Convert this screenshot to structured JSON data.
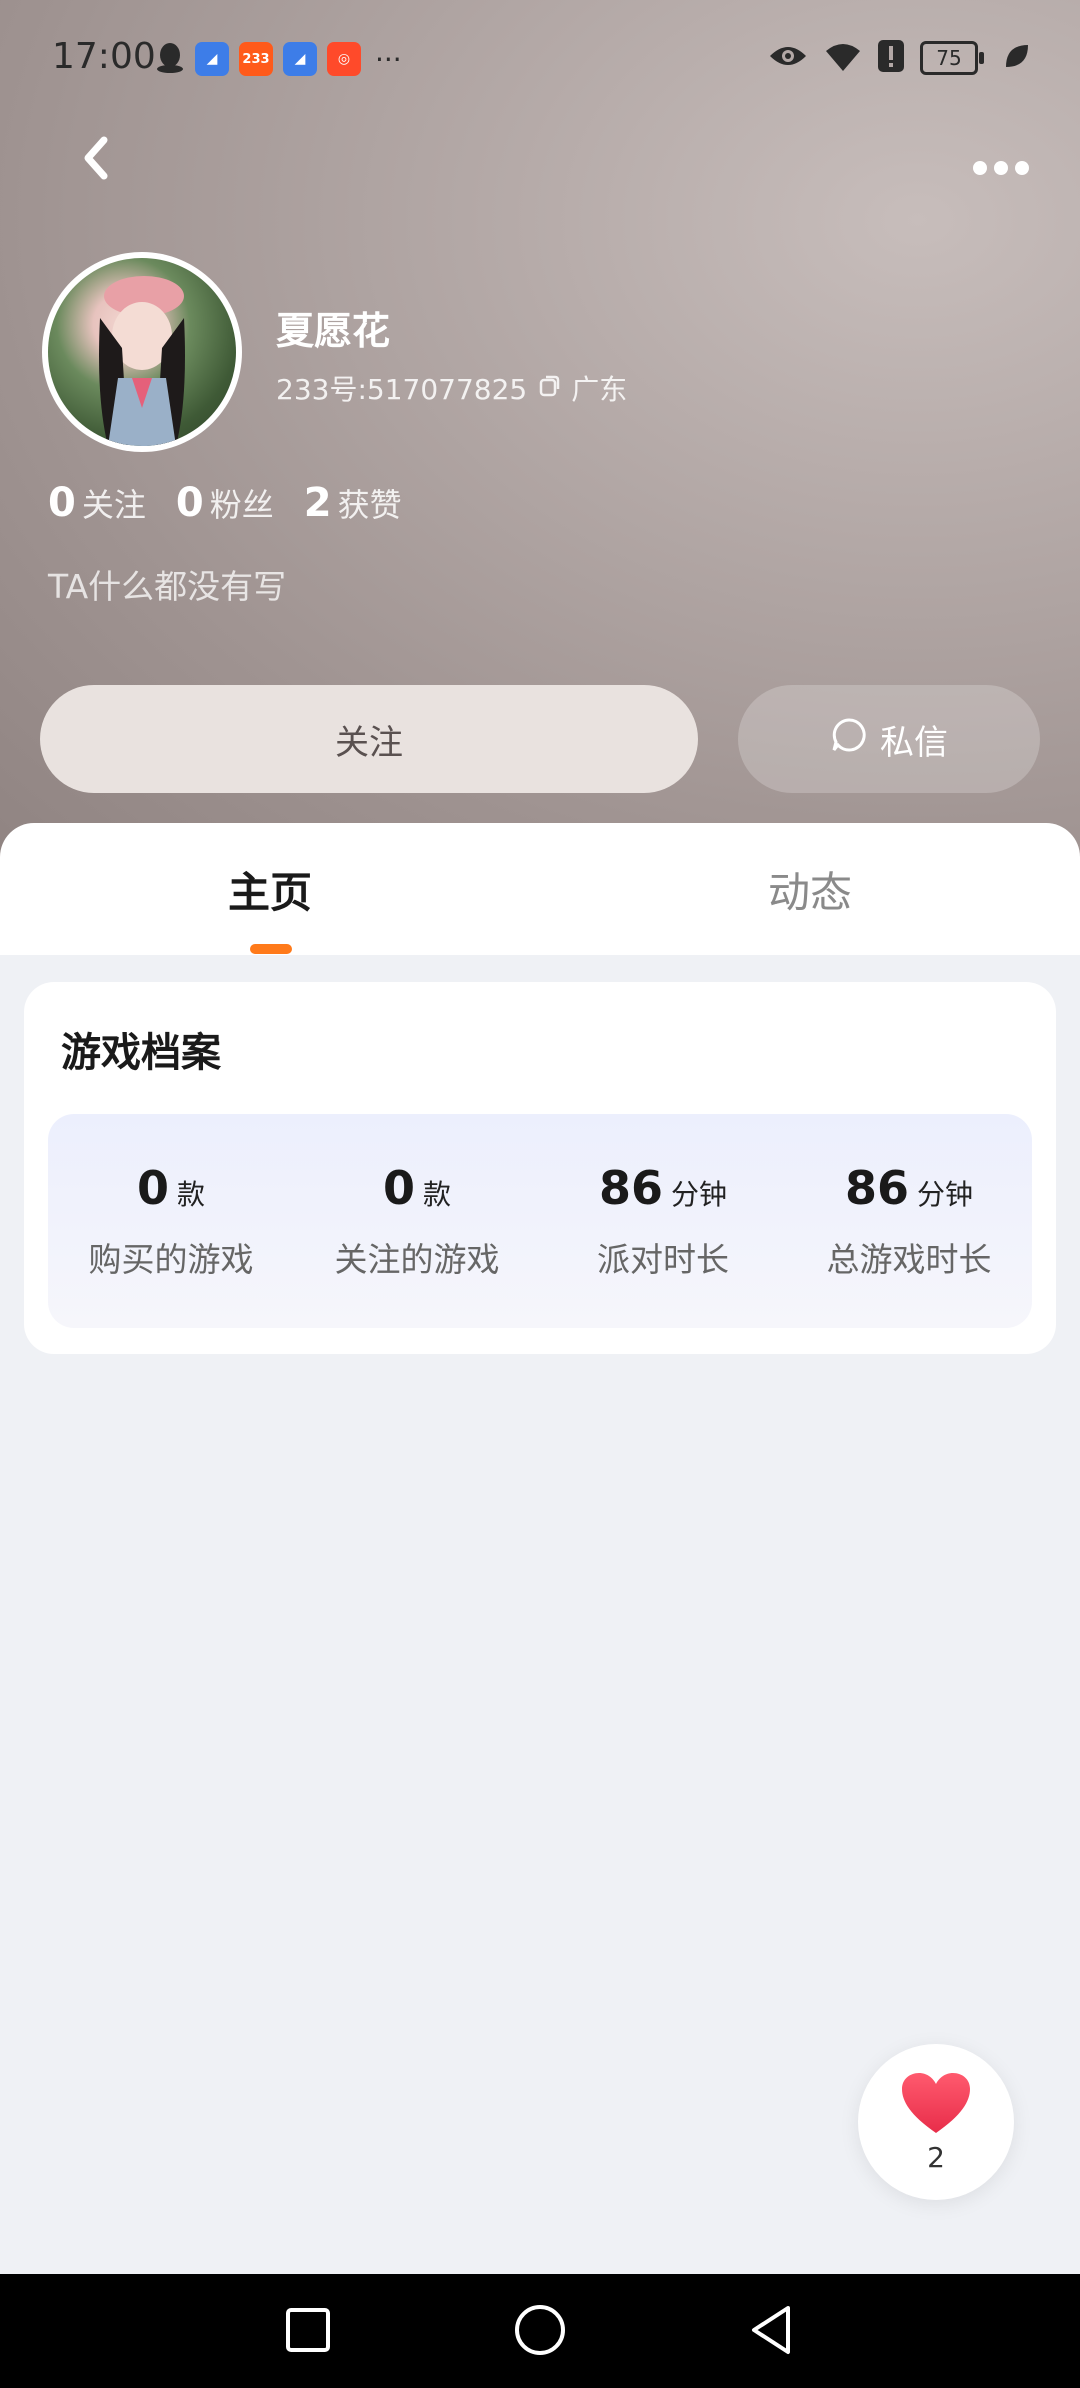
{
  "status_bar": {
    "time": "17:00",
    "notification_icons": [
      "qq-icon",
      "browser-icon",
      "233-app-icon",
      "browser-icon",
      "kuaishou-icon"
    ],
    "overflow": "···",
    "battery_level": "75"
  },
  "profile": {
    "username": "夏愿花",
    "uid": "233号:517077825",
    "location": "广东",
    "stats": [
      {
        "num": "0",
        "label": "关注"
      },
      {
        "num": "0",
        "label": "粉丝"
      },
      {
        "num": "2",
        "label": "获赞"
      }
    ],
    "bio": "TA什么都没有写"
  },
  "actions": {
    "follow": "关注",
    "message": "私信"
  },
  "tabs": [
    {
      "label": "主页",
      "active": true
    },
    {
      "label": "动态",
      "active": false
    }
  ],
  "game_profile": {
    "title": "游戏档案",
    "items": [
      {
        "value": "0",
        "unit": "款",
        "label": "购买的游戏"
      },
      {
        "value": "0",
        "unit": "款",
        "label": "关注的游戏"
      },
      {
        "value": "86",
        "unit": "分钟",
        "label": "派对时长"
      },
      {
        "value": "86",
        "unit": "分钟",
        "label": "总游戏时长"
      }
    ]
  },
  "likes": {
    "count": "2"
  },
  "colors": {
    "accent": "#ff7a1a",
    "heart": "#f0455a"
  }
}
